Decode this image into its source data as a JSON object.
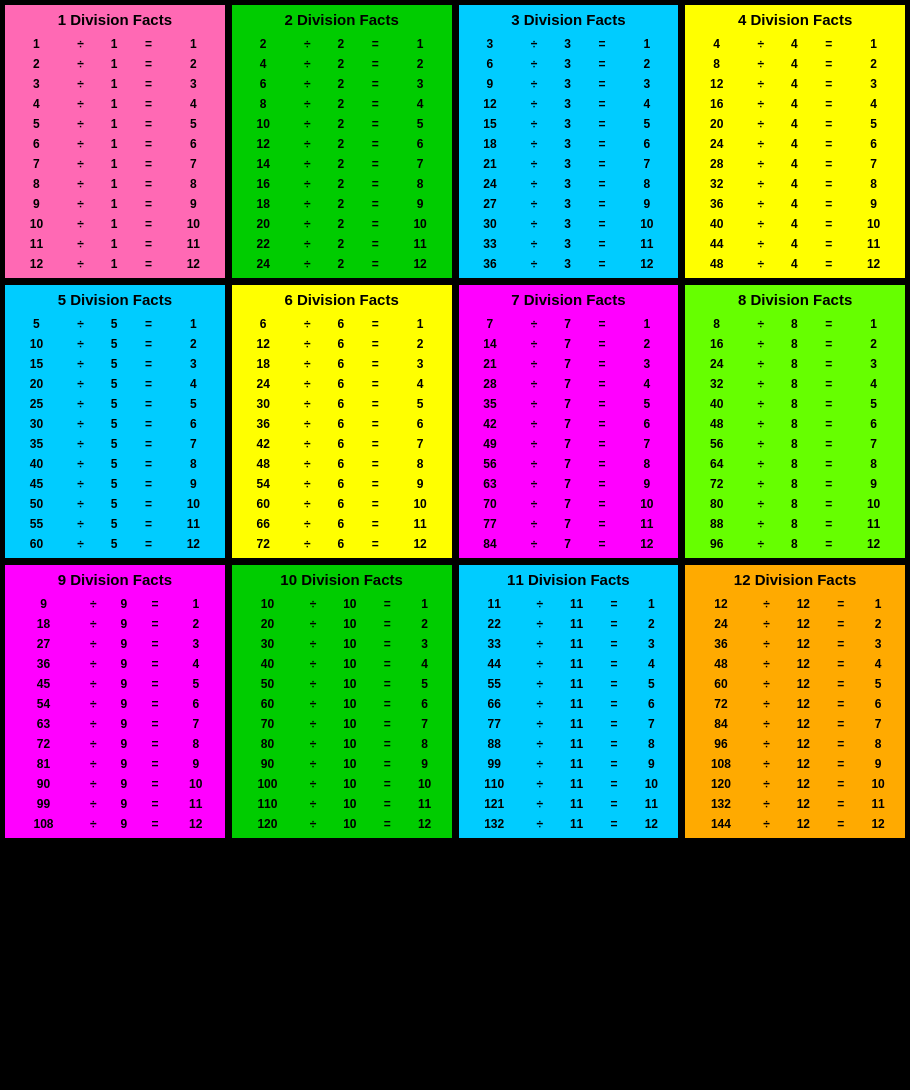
{
  "cards": [
    {
      "id": 1,
      "title": "1 Division Facts",
      "color": "pink",
      "divisor": 1,
      "facts": [
        [
          "1",
          "÷",
          "1",
          "=",
          "1"
        ],
        [
          "2",
          "÷",
          "1",
          "=",
          "2"
        ],
        [
          "3",
          "÷",
          "1",
          "=",
          "3"
        ],
        [
          "4",
          "÷",
          "1",
          "=",
          "4"
        ],
        [
          "5",
          "÷",
          "1",
          "=",
          "5"
        ],
        [
          "6",
          "÷",
          "1",
          "=",
          "6"
        ],
        [
          "7",
          "÷",
          "1",
          "=",
          "7"
        ],
        [
          "8",
          "÷",
          "1",
          "=",
          "8"
        ],
        [
          "9",
          "÷",
          "1",
          "=",
          "9"
        ],
        [
          "10",
          "÷",
          "1",
          "=",
          "10"
        ],
        [
          "11",
          "÷",
          "1",
          "=",
          "11"
        ],
        [
          "12",
          "÷",
          "1",
          "=",
          "12"
        ]
      ]
    },
    {
      "id": 2,
      "title": "2 Division Facts",
      "color": "green",
      "divisor": 2,
      "facts": [
        [
          "2",
          "÷",
          "2",
          "=",
          "1"
        ],
        [
          "4",
          "÷",
          "2",
          "=",
          "2"
        ],
        [
          "6",
          "÷",
          "2",
          "=",
          "3"
        ],
        [
          "8",
          "÷",
          "2",
          "=",
          "4"
        ],
        [
          "10",
          "÷",
          "2",
          "=",
          "5"
        ],
        [
          "12",
          "÷",
          "2",
          "=",
          "6"
        ],
        [
          "14",
          "÷",
          "2",
          "=",
          "7"
        ],
        [
          "16",
          "÷",
          "2",
          "=",
          "8"
        ],
        [
          "18",
          "÷",
          "2",
          "=",
          "9"
        ],
        [
          "20",
          "÷",
          "2",
          "=",
          "10"
        ],
        [
          "22",
          "÷",
          "2",
          "=",
          "11"
        ],
        [
          "24",
          "÷",
          "2",
          "=",
          "12"
        ]
      ]
    },
    {
      "id": 3,
      "title": "3 Division Facts",
      "color": "cyan",
      "divisor": 3,
      "facts": [
        [
          "3",
          "÷",
          "3",
          "=",
          "1"
        ],
        [
          "6",
          "÷",
          "3",
          "=",
          "2"
        ],
        [
          "9",
          "÷",
          "3",
          "=",
          "3"
        ],
        [
          "12",
          "÷",
          "3",
          "=",
          "4"
        ],
        [
          "15",
          "÷",
          "3",
          "=",
          "5"
        ],
        [
          "18",
          "÷",
          "3",
          "=",
          "6"
        ],
        [
          "21",
          "÷",
          "3",
          "=",
          "7"
        ],
        [
          "24",
          "÷",
          "3",
          "=",
          "8"
        ],
        [
          "27",
          "÷",
          "3",
          "=",
          "9"
        ],
        [
          "30",
          "÷",
          "3",
          "=",
          "10"
        ],
        [
          "33",
          "÷",
          "3",
          "=",
          "11"
        ],
        [
          "36",
          "÷",
          "3",
          "=",
          "12"
        ]
      ]
    },
    {
      "id": 4,
      "title": "4 Division Facts",
      "color": "yellow",
      "divisor": 4,
      "facts": [
        [
          "4",
          "÷",
          "4",
          "=",
          "1"
        ],
        [
          "8",
          "÷",
          "4",
          "=",
          "2"
        ],
        [
          "12",
          "÷",
          "4",
          "=",
          "3"
        ],
        [
          "16",
          "÷",
          "4",
          "=",
          "4"
        ],
        [
          "20",
          "÷",
          "4",
          "=",
          "5"
        ],
        [
          "24",
          "÷",
          "4",
          "=",
          "6"
        ],
        [
          "28",
          "÷",
          "4",
          "=",
          "7"
        ],
        [
          "32",
          "÷",
          "4",
          "=",
          "8"
        ],
        [
          "36",
          "÷",
          "4",
          "=",
          "9"
        ],
        [
          "40",
          "÷",
          "4",
          "=",
          "10"
        ],
        [
          "44",
          "÷",
          "4",
          "=",
          "11"
        ],
        [
          "48",
          "÷",
          "4",
          "=",
          "12"
        ]
      ]
    },
    {
      "id": 5,
      "title": "5 Division Facts",
      "color": "cyan",
      "divisor": 5,
      "facts": [
        [
          "5",
          "÷",
          "5",
          "=",
          "1"
        ],
        [
          "10",
          "÷",
          "5",
          "=",
          "2"
        ],
        [
          "15",
          "÷",
          "5",
          "=",
          "3"
        ],
        [
          "20",
          "÷",
          "5",
          "=",
          "4"
        ],
        [
          "25",
          "÷",
          "5",
          "=",
          "5"
        ],
        [
          "30",
          "÷",
          "5",
          "=",
          "6"
        ],
        [
          "35",
          "÷",
          "5",
          "=",
          "7"
        ],
        [
          "40",
          "÷",
          "5",
          "=",
          "8"
        ],
        [
          "45",
          "÷",
          "5",
          "=",
          "9"
        ],
        [
          "50",
          "÷",
          "5",
          "=",
          "10"
        ],
        [
          "55",
          "÷",
          "5",
          "=",
          "11"
        ],
        [
          "60",
          "÷",
          "5",
          "=",
          "12"
        ]
      ]
    },
    {
      "id": 6,
      "title": "6 Division Facts",
      "color": "yellow",
      "divisor": 6,
      "facts": [
        [
          "6",
          "÷",
          "6",
          "=",
          "1"
        ],
        [
          "12",
          "÷",
          "6",
          "=",
          "2"
        ],
        [
          "18",
          "÷",
          "6",
          "=",
          "3"
        ],
        [
          "24",
          "÷",
          "6",
          "=",
          "4"
        ],
        [
          "30",
          "÷",
          "6",
          "=",
          "5"
        ],
        [
          "36",
          "÷",
          "6",
          "=",
          "6"
        ],
        [
          "42",
          "÷",
          "6",
          "=",
          "7"
        ],
        [
          "48",
          "÷",
          "6",
          "=",
          "8"
        ],
        [
          "54",
          "÷",
          "6",
          "=",
          "9"
        ],
        [
          "60",
          "÷",
          "6",
          "=",
          "10"
        ],
        [
          "66",
          "÷",
          "6",
          "=",
          "11"
        ],
        [
          "72",
          "÷",
          "6",
          "=",
          "12"
        ]
      ]
    },
    {
      "id": 7,
      "title": "7 Division Facts",
      "color": "magenta",
      "divisor": 7,
      "facts": [
        [
          "7",
          "÷",
          "7",
          "=",
          "1"
        ],
        [
          "14",
          "÷",
          "7",
          "=",
          "2"
        ],
        [
          "21",
          "÷",
          "7",
          "=",
          "3"
        ],
        [
          "28",
          "÷",
          "7",
          "=",
          "4"
        ],
        [
          "35",
          "÷",
          "7",
          "=",
          "5"
        ],
        [
          "42",
          "÷",
          "7",
          "=",
          "6"
        ],
        [
          "49",
          "÷",
          "7",
          "=",
          "7"
        ],
        [
          "56",
          "÷",
          "7",
          "=",
          "8"
        ],
        [
          "63",
          "÷",
          "7",
          "=",
          "9"
        ],
        [
          "70",
          "÷",
          "7",
          "=",
          "10"
        ],
        [
          "77",
          "÷",
          "7",
          "=",
          "11"
        ],
        [
          "84",
          "÷",
          "7",
          "=",
          "12"
        ]
      ]
    },
    {
      "id": 8,
      "title": "8 Division Facts",
      "color": "lime",
      "divisor": 8,
      "facts": [
        [
          "8",
          "÷",
          "8",
          "=",
          "1"
        ],
        [
          "16",
          "÷",
          "8",
          "=",
          "2"
        ],
        [
          "24",
          "÷",
          "8",
          "=",
          "3"
        ],
        [
          "32",
          "÷",
          "8",
          "=",
          "4"
        ],
        [
          "40",
          "÷",
          "8",
          "=",
          "5"
        ],
        [
          "48",
          "÷",
          "8",
          "=",
          "6"
        ],
        [
          "56",
          "÷",
          "8",
          "=",
          "7"
        ],
        [
          "64",
          "÷",
          "8",
          "=",
          "8"
        ],
        [
          "72",
          "÷",
          "8",
          "=",
          "9"
        ],
        [
          "80",
          "÷",
          "8",
          "=",
          "10"
        ],
        [
          "88",
          "÷",
          "8",
          "=",
          "11"
        ],
        [
          "96",
          "÷",
          "8",
          "=",
          "12"
        ]
      ]
    },
    {
      "id": 9,
      "title": "9 Division Facts",
      "color": "magenta",
      "divisor": 9,
      "facts": [
        [
          "9",
          "÷",
          "9",
          "=",
          "1"
        ],
        [
          "18",
          "÷",
          "9",
          "=",
          "2"
        ],
        [
          "27",
          "÷",
          "9",
          "=",
          "3"
        ],
        [
          "36",
          "÷",
          "9",
          "=",
          "4"
        ],
        [
          "45",
          "÷",
          "9",
          "=",
          "5"
        ],
        [
          "54",
          "÷",
          "9",
          "=",
          "6"
        ],
        [
          "63",
          "÷",
          "9",
          "=",
          "7"
        ],
        [
          "72",
          "÷",
          "9",
          "=",
          "8"
        ],
        [
          "81",
          "÷",
          "9",
          "=",
          "9"
        ],
        [
          "90",
          "÷",
          "9",
          "=",
          "10"
        ],
        [
          "99",
          "÷",
          "9",
          "=",
          "11"
        ],
        [
          "108",
          "÷",
          "9",
          "=",
          "12"
        ]
      ]
    },
    {
      "id": 10,
      "title": "10 Division Facts",
      "color": "green",
      "divisor": 10,
      "facts": [
        [
          "10",
          "÷",
          "10",
          "=",
          "1"
        ],
        [
          "20",
          "÷",
          "10",
          "=",
          "2"
        ],
        [
          "30",
          "÷",
          "10",
          "=",
          "3"
        ],
        [
          "40",
          "÷",
          "10",
          "=",
          "4"
        ],
        [
          "50",
          "÷",
          "10",
          "=",
          "5"
        ],
        [
          "60",
          "÷",
          "10",
          "=",
          "6"
        ],
        [
          "70",
          "÷",
          "10",
          "=",
          "7"
        ],
        [
          "80",
          "÷",
          "10",
          "=",
          "8"
        ],
        [
          "90",
          "÷",
          "10",
          "=",
          "9"
        ],
        [
          "100",
          "÷",
          "10",
          "=",
          "10"
        ],
        [
          "110",
          "÷",
          "10",
          "=",
          "11"
        ],
        [
          "120",
          "÷",
          "10",
          "=",
          "12"
        ]
      ]
    },
    {
      "id": 11,
      "title": "11 Division Facts",
      "color": "cyan",
      "divisor": 11,
      "facts": [
        [
          "11",
          "÷",
          "11",
          "=",
          "1"
        ],
        [
          "22",
          "÷",
          "11",
          "=",
          "2"
        ],
        [
          "33",
          "÷",
          "11",
          "=",
          "3"
        ],
        [
          "44",
          "÷",
          "11",
          "=",
          "4"
        ],
        [
          "55",
          "÷",
          "11",
          "=",
          "5"
        ],
        [
          "66",
          "÷",
          "11",
          "=",
          "6"
        ],
        [
          "77",
          "÷",
          "11",
          "=",
          "7"
        ],
        [
          "88",
          "÷",
          "11",
          "=",
          "8"
        ],
        [
          "99",
          "÷",
          "11",
          "=",
          "9"
        ],
        [
          "110",
          "÷",
          "11",
          "=",
          "10"
        ],
        [
          "121",
          "÷",
          "11",
          "=",
          "11"
        ],
        [
          "132",
          "÷",
          "11",
          "=",
          "12"
        ]
      ]
    },
    {
      "id": 12,
      "title": "12 Division Facts",
      "color": "orange",
      "divisor": 12,
      "facts": [
        [
          "12",
          "÷",
          "12",
          "=",
          "1"
        ],
        [
          "24",
          "÷",
          "12",
          "=",
          "2"
        ],
        [
          "36",
          "÷",
          "12",
          "=",
          "3"
        ],
        [
          "48",
          "÷",
          "12",
          "=",
          "4"
        ],
        [
          "60",
          "÷",
          "12",
          "=",
          "5"
        ],
        [
          "72",
          "÷",
          "12",
          "=",
          "6"
        ],
        [
          "84",
          "÷",
          "12",
          "=",
          "7"
        ],
        [
          "96",
          "÷",
          "12",
          "=",
          "8"
        ],
        [
          "108",
          "÷",
          "12",
          "=",
          "9"
        ],
        [
          "120",
          "÷",
          "12",
          "=",
          "10"
        ],
        [
          "132",
          "÷",
          "12",
          "=",
          "11"
        ],
        [
          "144",
          "÷",
          "12",
          "=",
          "12"
        ]
      ]
    }
  ],
  "colors": {
    "pink": "#FF69B4",
    "green": "#00CC00",
    "cyan": "#00CCFF",
    "yellow": "#FFFF00",
    "magenta": "#FF00FF",
    "lime": "#66FF00",
    "orange": "#FFAA00"
  }
}
